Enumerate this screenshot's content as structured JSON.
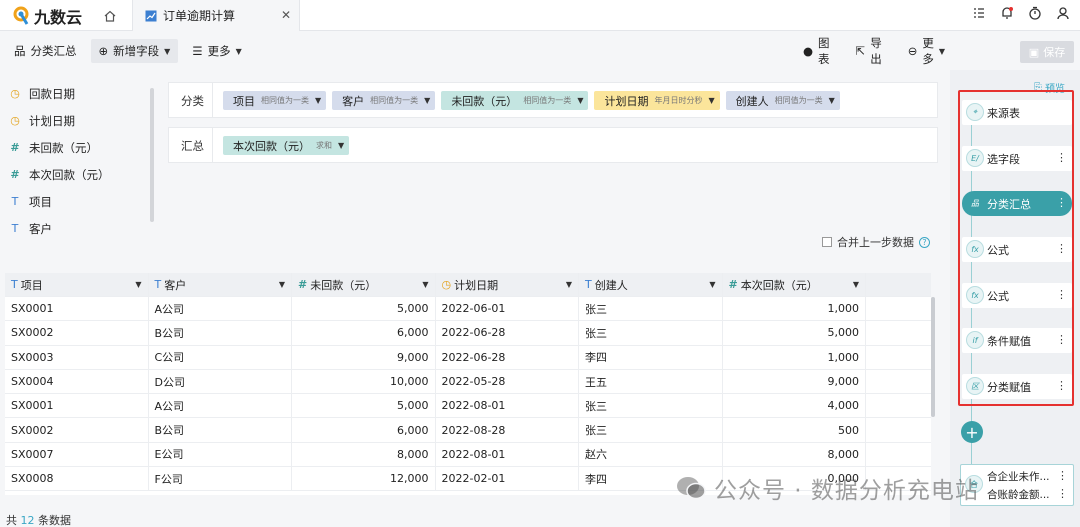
{
  "app": {
    "logo_text": "九数云",
    "tab_title": "订单逾期计算",
    "tab_close": "✕"
  },
  "toolbar": {
    "group_summary": "分类汇总",
    "add_field": "新增字段",
    "more_left": "更多",
    "chart": "图表",
    "export": "导出",
    "more_right": "更多",
    "save": "保存"
  },
  "fields": [
    {
      "type": "date",
      "icon": "◷",
      "label": "回款日期"
    },
    {
      "type": "date",
      "icon": "◷",
      "label": "计划日期"
    },
    {
      "type": "num",
      "icon": "#",
      "label": "未回款（元）"
    },
    {
      "type": "num",
      "icon": "#",
      "label": "本次回款（元）"
    },
    {
      "type": "text",
      "icon": "T",
      "label": "项目"
    },
    {
      "type": "text",
      "icon": "T",
      "label": "客户"
    }
  ],
  "config": {
    "group_label": "分类",
    "group_chips": [
      {
        "label": "项目",
        "sub": "相同值为一类",
        "color": "blue"
      },
      {
        "label": "客户",
        "sub": "相同值为一类",
        "color": "blue"
      },
      {
        "label": "未回款（元）",
        "sub": "相同值为一类",
        "color": "teal"
      },
      {
        "label": "计划日期",
        "sub": "年月日时分秒",
        "color": "yellow"
      },
      {
        "label": "创建人",
        "sub": "相同值为一类",
        "color": "blue"
      }
    ],
    "summary_label": "汇总",
    "summary_chips": [
      {
        "label": "本次回款（元）",
        "sub": "求和",
        "color": "teal"
      }
    ]
  },
  "merge_previous": {
    "label": "合并上一步数据",
    "checked": false
  },
  "table": {
    "columns": [
      {
        "icon": "T",
        "type": "text",
        "label": "项目"
      },
      {
        "icon": "T",
        "type": "text",
        "label": "客户"
      },
      {
        "icon": "#",
        "type": "num",
        "label": "未回款（元）"
      },
      {
        "icon": "◷",
        "type": "date",
        "label": "计划日期"
      },
      {
        "icon": "T",
        "type": "text",
        "label": "创建人"
      },
      {
        "icon": "#",
        "type": "num",
        "label": "本次回款（元）"
      }
    ],
    "rows": [
      [
        "SX0001",
        "A公司",
        "5,000",
        "2022-06-01",
        "张三",
        "1,000"
      ],
      [
        "SX0002",
        "B公司",
        "6,000",
        "2022-06-28",
        "张三",
        "5,000"
      ],
      [
        "SX0003",
        "C公司",
        "9,000",
        "2022-06-28",
        "李四",
        "1,000"
      ],
      [
        "SX0004",
        "D公司",
        "10,000",
        "2022-05-28",
        "王五",
        "9,000"
      ],
      [
        "SX0001",
        "A公司",
        "5,000",
        "2022-08-01",
        "张三",
        "4,000"
      ],
      [
        "SX0002",
        "B公司",
        "6,000",
        "2022-08-28",
        "张三",
        "500"
      ],
      [
        "SX0007",
        "E公司",
        "8,000",
        "2022-08-01",
        "赵六",
        "8,000"
      ],
      [
        "SX0008",
        "F公司",
        "12,000",
        "2022-02-01",
        "李四",
        "0,000"
      ]
    ]
  },
  "footer": {
    "prefix": "共",
    "count": "12",
    "suffix": "条数据"
  },
  "pipeline": {
    "preview": "预览",
    "steps": [
      {
        "icon": "⌖",
        "label": "来源表",
        "active": false,
        "more": false
      },
      {
        "icon": "E/",
        "label": "选字段",
        "active": false,
        "more": true
      },
      {
        "icon": "品",
        "label": "分类汇总",
        "active": true,
        "more": true
      },
      {
        "icon": "fx",
        "label": "公式",
        "active": false,
        "more": true
      },
      {
        "icon": "fx",
        "label": "公式",
        "active": false,
        "more": true
      },
      {
        "icon": "if",
        "label": "条件赋值",
        "active": false,
        "more": true
      },
      {
        "icon": "区",
        "label": "分类赋值",
        "active": false,
        "more": true
      }
    ],
    "add": "+",
    "merged_lines": [
      "合企业未作...",
      "合账龄金额..."
    ]
  },
  "watermark": "公众号 · 数据分析充电站"
}
